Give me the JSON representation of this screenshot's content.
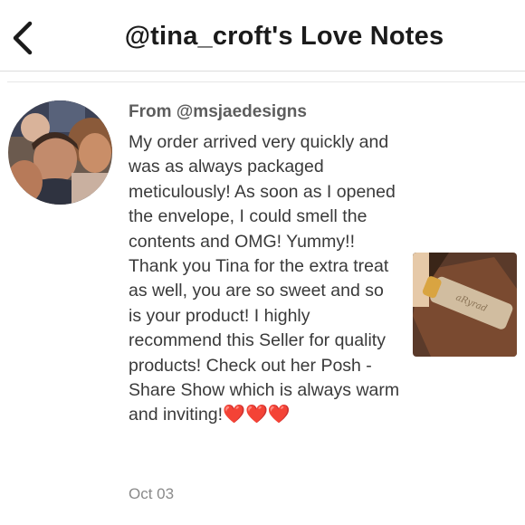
{
  "header": {
    "title": "@tina_croft's Love Notes",
    "back_icon": "chevron-left-icon"
  },
  "note": {
    "from": "From @msjaedesigns",
    "message": "My order arrived very quickly and was as always packaged meticulously! As soon as I opened the envelope, I could smell the contents and OMG! Yummy!! Thank you Tina for the extra treat as well, you are so sweet and so is your product! I highly recommend this Seller for quality products! Check out her Posh - Share Show which is always warm and inviting!",
    "hearts": "❤️❤️❤️",
    "date": "Oct 03"
  },
  "colors": {
    "heart": "#e0245e",
    "text": "#3a3a3a",
    "muted": "#8a8a8a"
  }
}
